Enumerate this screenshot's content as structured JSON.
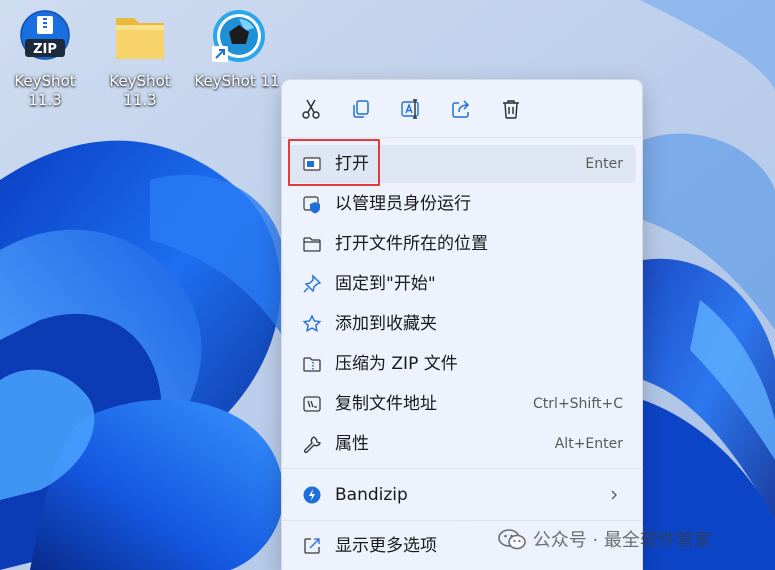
{
  "desktop": {
    "icons": [
      {
        "label": "KeyShot\n11.3",
        "line1": "KeyShot",
        "line2": "11.3",
        "icon": "zip-archive-icon"
      },
      {
        "label": "KeyShot 11.3",
        "line1": "KeyShot",
        "line2": "11.3",
        "icon": "folder-icon"
      },
      {
        "label": "KeyShot 11",
        "line1": "KeyShot 11",
        "line2": "",
        "icon": "keyshot-shortcut-icon"
      }
    ]
  },
  "context_menu": {
    "toolbar": [
      {
        "name": "cut",
        "icon": "scissors-icon"
      },
      {
        "name": "copy",
        "icon": "copy-icon"
      },
      {
        "name": "rename",
        "icon": "rename-icon"
      },
      {
        "name": "share",
        "icon": "share-icon"
      },
      {
        "name": "delete",
        "icon": "trash-icon"
      }
    ],
    "items": [
      {
        "label": "打开",
        "shortcut": "Enter",
        "icon": "app-window-icon"
      },
      {
        "label": "以管理员身份运行",
        "shortcut": "",
        "icon": "shield-icon"
      },
      {
        "label": "打开文件所在的位置",
        "shortcut": "",
        "icon": "folder-outline-icon"
      },
      {
        "label": "固定到\"开始\"",
        "shortcut": "",
        "icon": "pin-icon"
      },
      {
        "label": "添加到收藏夹",
        "shortcut": "",
        "icon": "star-icon"
      },
      {
        "label": "压缩为 ZIP 文件",
        "shortcut": "",
        "icon": "zip-folder-icon"
      },
      {
        "label": "复制文件地址",
        "shortcut": "Ctrl+Shift+C",
        "icon": "copy-path-icon"
      },
      {
        "label": "属性",
        "shortcut": "Alt+Enter",
        "icon": "wrench-icon"
      },
      {
        "label": "Bandizip",
        "shortcut": "",
        "icon": "bandizip-icon"
      },
      {
        "label": "显示更多选项",
        "shortcut": "",
        "icon": "external-link-icon"
      }
    ]
  },
  "watermark": {
    "text": "公众号 · 最全软件管家"
  },
  "colors": {
    "accent": "#1f6fd8",
    "highlight_border": "#e33a3a",
    "menu_bg": "#eef3fc"
  }
}
